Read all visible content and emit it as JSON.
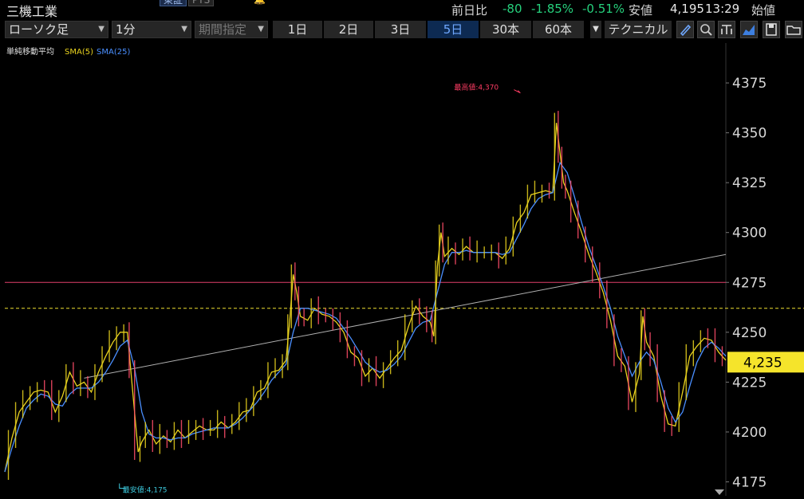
{
  "header": {
    "title": "三機工業",
    "markets": [
      "東証",
      "PTS"
    ],
    "prev_label": "前日比",
    "change": "-80",
    "change_pct": "-1.85%",
    "change_pct2": "-0.51%",
    "low_label": "安値",
    "low_value": "4,195",
    "time": "13:29",
    "open_label": "始値"
  },
  "toolbar": {
    "chart_type": "ローソク足",
    "interval": "1分",
    "period": "期間指定",
    "ranges": [
      "1日",
      "2日",
      "3日",
      "5日",
      "30本",
      "60本"
    ],
    "selected_range": "5日",
    "technical": "テクニカル"
  },
  "colors": {
    "up": "#e8d21e",
    "down": "#ff4d6a",
    "sma5": "#e8d21e",
    "sma25": "#4a8fff",
    "highline": "#e0406a",
    "dash": "#f0e030",
    "trend": "#b0b0b0",
    "price_tag": "#f5e42b"
  },
  "chart_data": {
    "type": "line",
    "indicator_label": "単純移動平均",
    "legend": [
      "SMA(5)",
      "SMA(25)"
    ],
    "y_ticks": [
      "4375",
      "4350",
      "4325",
      "4300",
      "4275",
      "4250",
      "4225",
      "4200",
      "4175"
    ],
    "ylim": [
      4168,
      4395
    ],
    "x_range": [
      0,
      100
    ],
    "high_label": "最高値:4,370",
    "low_label": "最安値:4,175",
    "high": {
      "x": 71.5,
      "y": 4370
    },
    "low": {
      "x": 15.9,
      "y": 4175
    },
    "current_price": "4,235",
    "current_value": 4235,
    "hline": 4275,
    "dashed_line": 4262,
    "trend_line": [
      [
        11,
        4227
      ],
      [
        100,
        4289
      ]
    ],
    "series": [
      {
        "values": [
          [
            0,
            4180
          ],
          [
            1,
            4197
          ],
          [
            2,
            4210
          ],
          [
            3,
            4215
          ],
          [
            4,
            4220
          ],
          [
            5,
            4221
          ],
          [
            6,
            4220
          ],
          [
            7,
            4210
          ],
          [
            8,
            4218
          ],
          [
            9,
            4230
          ],
          [
            10,
            4223
          ],
          [
            11,
            4225
          ],
          [
            12,
            4220
          ],
          [
            13,
            4230
          ],
          [
            14,
            4238
          ],
          [
            15,
            4245
          ],
          [
            16,
            4250
          ],
          [
            17,
            4250
          ],
          [
            17.5,
            4230
          ],
          [
            18.5,
            4190
          ],
          [
            19,
            4195
          ],
          [
            20,
            4201
          ],
          [
            21,
            4194
          ],
          [
            22,
            4198
          ],
          [
            23,
            4195
          ],
          [
            24,
            4201
          ],
          [
            25,
            4197
          ],
          [
            26,
            4200
          ],
          [
            27,
            4203
          ],
          [
            28,
            4201
          ],
          [
            29,
            4201
          ],
          [
            30,
            4205
          ],
          [
            31,
            4202
          ],
          [
            32,
            4205
          ],
          [
            33,
            4210
          ],
          [
            34,
            4211
          ],
          [
            35,
            4220
          ],
          [
            36,
            4222
          ],
          [
            37,
            4230
          ],
          [
            38,
            4231
          ],
          [
            39,
            4236
          ],
          [
            39.5,
            4255
          ],
          [
            40,
            4279
          ],
          [
            40.5,
            4270
          ],
          [
            41,
            4258
          ],
          [
            42,
            4256
          ],
          [
            43,
            4262
          ],
          [
            44,
            4259
          ],
          [
            45,
            4258
          ],
          [
            46,
            4255
          ],
          [
            47,
            4250
          ],
          [
            48,
            4240
          ],
          [
            49,
            4237
          ],
          [
            50,
            4228
          ],
          [
            51,
            4232
          ],
          [
            52,
            4227
          ],
          [
            53,
            4232
          ],
          [
            54,
            4237
          ],
          [
            55,
            4241
          ],
          [
            56,
            4253
          ],
          [
            57,
            4263
          ],
          [
            58,
            4258
          ],
          [
            59,
            4255
          ],
          [
            59.5,
            4248
          ],
          [
            60,
            4283
          ],
          [
            60.5,
            4300
          ],
          [
            61,
            4288
          ],
          [
            62,
            4292
          ],
          [
            63,
            4289
          ],
          [
            64,
            4293
          ],
          [
            65,
            4290
          ],
          [
            66,
            4290
          ],
          [
            67,
            4290
          ],
          [
            68,
            4290
          ],
          [
            69,
            4287
          ],
          [
            70,
            4292
          ],
          [
            71,
            4305
          ],
          [
            72,
            4310
          ],
          [
            73,
            4319
          ],
          [
            74,
            4320
          ],
          [
            75,
            4321
          ],
          [
            76,
            4320
          ],
          [
            76.5,
            4355
          ],
          [
            77,
            4340
          ],
          [
            77.5,
            4325
          ],
          [
            78,
            4321
          ],
          [
            79,
            4310
          ],
          [
            80,
            4300
          ],
          [
            81,
            4289
          ],
          [
            82,
            4280
          ],
          [
            83,
            4270
          ],
          [
            84,
            4256
          ],
          [
            85,
            4238
          ],
          [
            86,
            4233
          ],
          [
            87,
            4215
          ],
          [
            88,
            4229
          ],
          [
            88.5,
            4258
          ],
          [
            89,
            4245
          ],
          [
            90,
            4238
          ],
          [
            91,
            4218
          ],
          [
            92,
            4204
          ],
          [
            93,
            4203
          ],
          [
            94,
            4220
          ],
          [
            95,
            4238
          ],
          [
            96,
            4243
          ],
          [
            97,
            4247
          ],
          [
            98,
            4246
          ],
          [
            99,
            4240
          ],
          [
            100,
            4236
          ]
        ]
      },
      {
        "values": [
          [
            0,
            4180
          ],
          [
            1,
            4192
          ],
          [
            2,
            4203
          ],
          [
            3,
            4212
          ],
          [
            4,
            4216
          ],
          [
            5,
            4219
          ],
          [
            6,
            4218
          ],
          [
            7,
            4214
          ],
          [
            8,
            4213
          ],
          [
            9,
            4219
          ],
          [
            10,
            4222
          ],
          [
            11,
            4222
          ],
          [
            12,
            4222
          ],
          [
            13,
            4225
          ],
          [
            14,
            4230
          ],
          [
            15,
            4236
          ],
          [
            16,
            4243
          ],
          [
            17,
            4246
          ],
          [
            18,
            4232
          ],
          [
            19,
            4210
          ],
          [
            20,
            4199
          ],
          [
            21,
            4197
          ],
          [
            22,
            4197
          ],
          [
            23,
            4196
          ],
          [
            24,
            4197
          ],
          [
            25,
            4197
          ],
          [
            26,
            4199
          ],
          [
            27,
            4200
          ],
          [
            28,
            4201
          ],
          [
            29,
            4202
          ],
          [
            30,
            4202
          ],
          [
            31,
            4202
          ],
          [
            32,
            4204
          ],
          [
            33,
            4207
          ],
          [
            34,
            4211
          ],
          [
            35,
            4215
          ],
          [
            36,
            4220
          ],
          [
            37,
            4226
          ],
          [
            38,
            4230
          ],
          [
            39,
            4234
          ],
          [
            40,
            4250
          ],
          [
            41,
            4262
          ],
          [
            42,
            4262
          ],
          [
            43,
            4261
          ],
          [
            44,
            4260
          ],
          [
            45,
            4259
          ],
          [
            46,
            4257
          ],
          [
            47,
            4252
          ],
          [
            48,
            4247
          ],
          [
            49,
            4241
          ],
          [
            50,
            4235
          ],
          [
            51,
            4232
          ],
          [
            52,
            4230
          ],
          [
            53,
            4231
          ],
          [
            54,
            4234
          ],
          [
            55,
            4238
          ],
          [
            56,
            4245
          ],
          [
            57,
            4252
          ],
          [
            58,
            4255
          ],
          [
            59,
            4256
          ],
          [
            60,
            4270
          ],
          [
            61,
            4284
          ],
          [
            62,
            4290
          ],
          [
            63,
            4290
          ],
          [
            64,
            4291
          ],
          [
            65,
            4290
          ],
          [
            66,
            4290
          ],
          [
            67,
            4290
          ],
          [
            68,
            4290
          ],
          [
            69,
            4289
          ],
          [
            70,
            4290
          ],
          [
            71,
            4297
          ],
          [
            72,
            4304
          ],
          [
            73,
            4312
          ],
          [
            74,
            4317
          ],
          [
            75,
            4319
          ],
          [
            76,
            4320
          ],
          [
            77,
            4335
          ],
          [
            78,
            4330
          ],
          [
            79,
            4318
          ],
          [
            80,
            4305
          ],
          [
            81,
            4293
          ],
          [
            82,
            4283
          ],
          [
            83,
            4273
          ],
          [
            84,
            4262
          ],
          [
            85,
            4248
          ],
          [
            86,
            4238
          ],
          [
            87,
            4228
          ],
          [
            88,
            4235
          ],
          [
            89,
            4240
          ],
          [
            90,
            4236
          ],
          [
            91,
            4225
          ],
          [
            92,
            4212
          ],
          [
            93,
            4205
          ],
          [
            94,
            4210
          ],
          [
            95,
            4223
          ],
          [
            96,
            4235
          ],
          [
            97,
            4242
          ],
          [
            98,
            4245
          ],
          [
            99,
            4242
          ],
          [
            100,
            4238
          ]
        ]
      }
    ]
  }
}
